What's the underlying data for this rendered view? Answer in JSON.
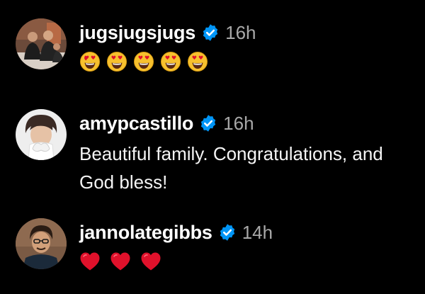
{
  "comments": [
    {
      "username": "jugsjugsjugs",
      "verified": true,
      "time": "16h",
      "avatar_icon": "group-photo-avatar",
      "reactions": [
        "heart-eyes-emoji",
        "heart-eyes-emoji",
        "heart-eyes-emoji",
        "heart-eyes-emoji",
        "heart-eyes-emoji"
      ]
    },
    {
      "username": "amypcastillo",
      "verified": true,
      "time": "16h",
      "avatar_icon": "woman-photo-avatar",
      "text": "Beautiful family. Congratulations, and God bless!"
    },
    {
      "username": "jannolategibbs",
      "verified": true,
      "time": "14h",
      "avatar_icon": "man-photo-avatar",
      "reactions": [
        "red-heart-emoji",
        "red-heart-emoji",
        "red-heart-emoji"
      ]
    }
  ],
  "colors": {
    "background": "#000000",
    "username": "#ffffff",
    "timestamp": "#a8a8a8",
    "verified_badge": "#0095f6",
    "heart": "#e0112b",
    "emoji_face": "#f7c12e"
  }
}
